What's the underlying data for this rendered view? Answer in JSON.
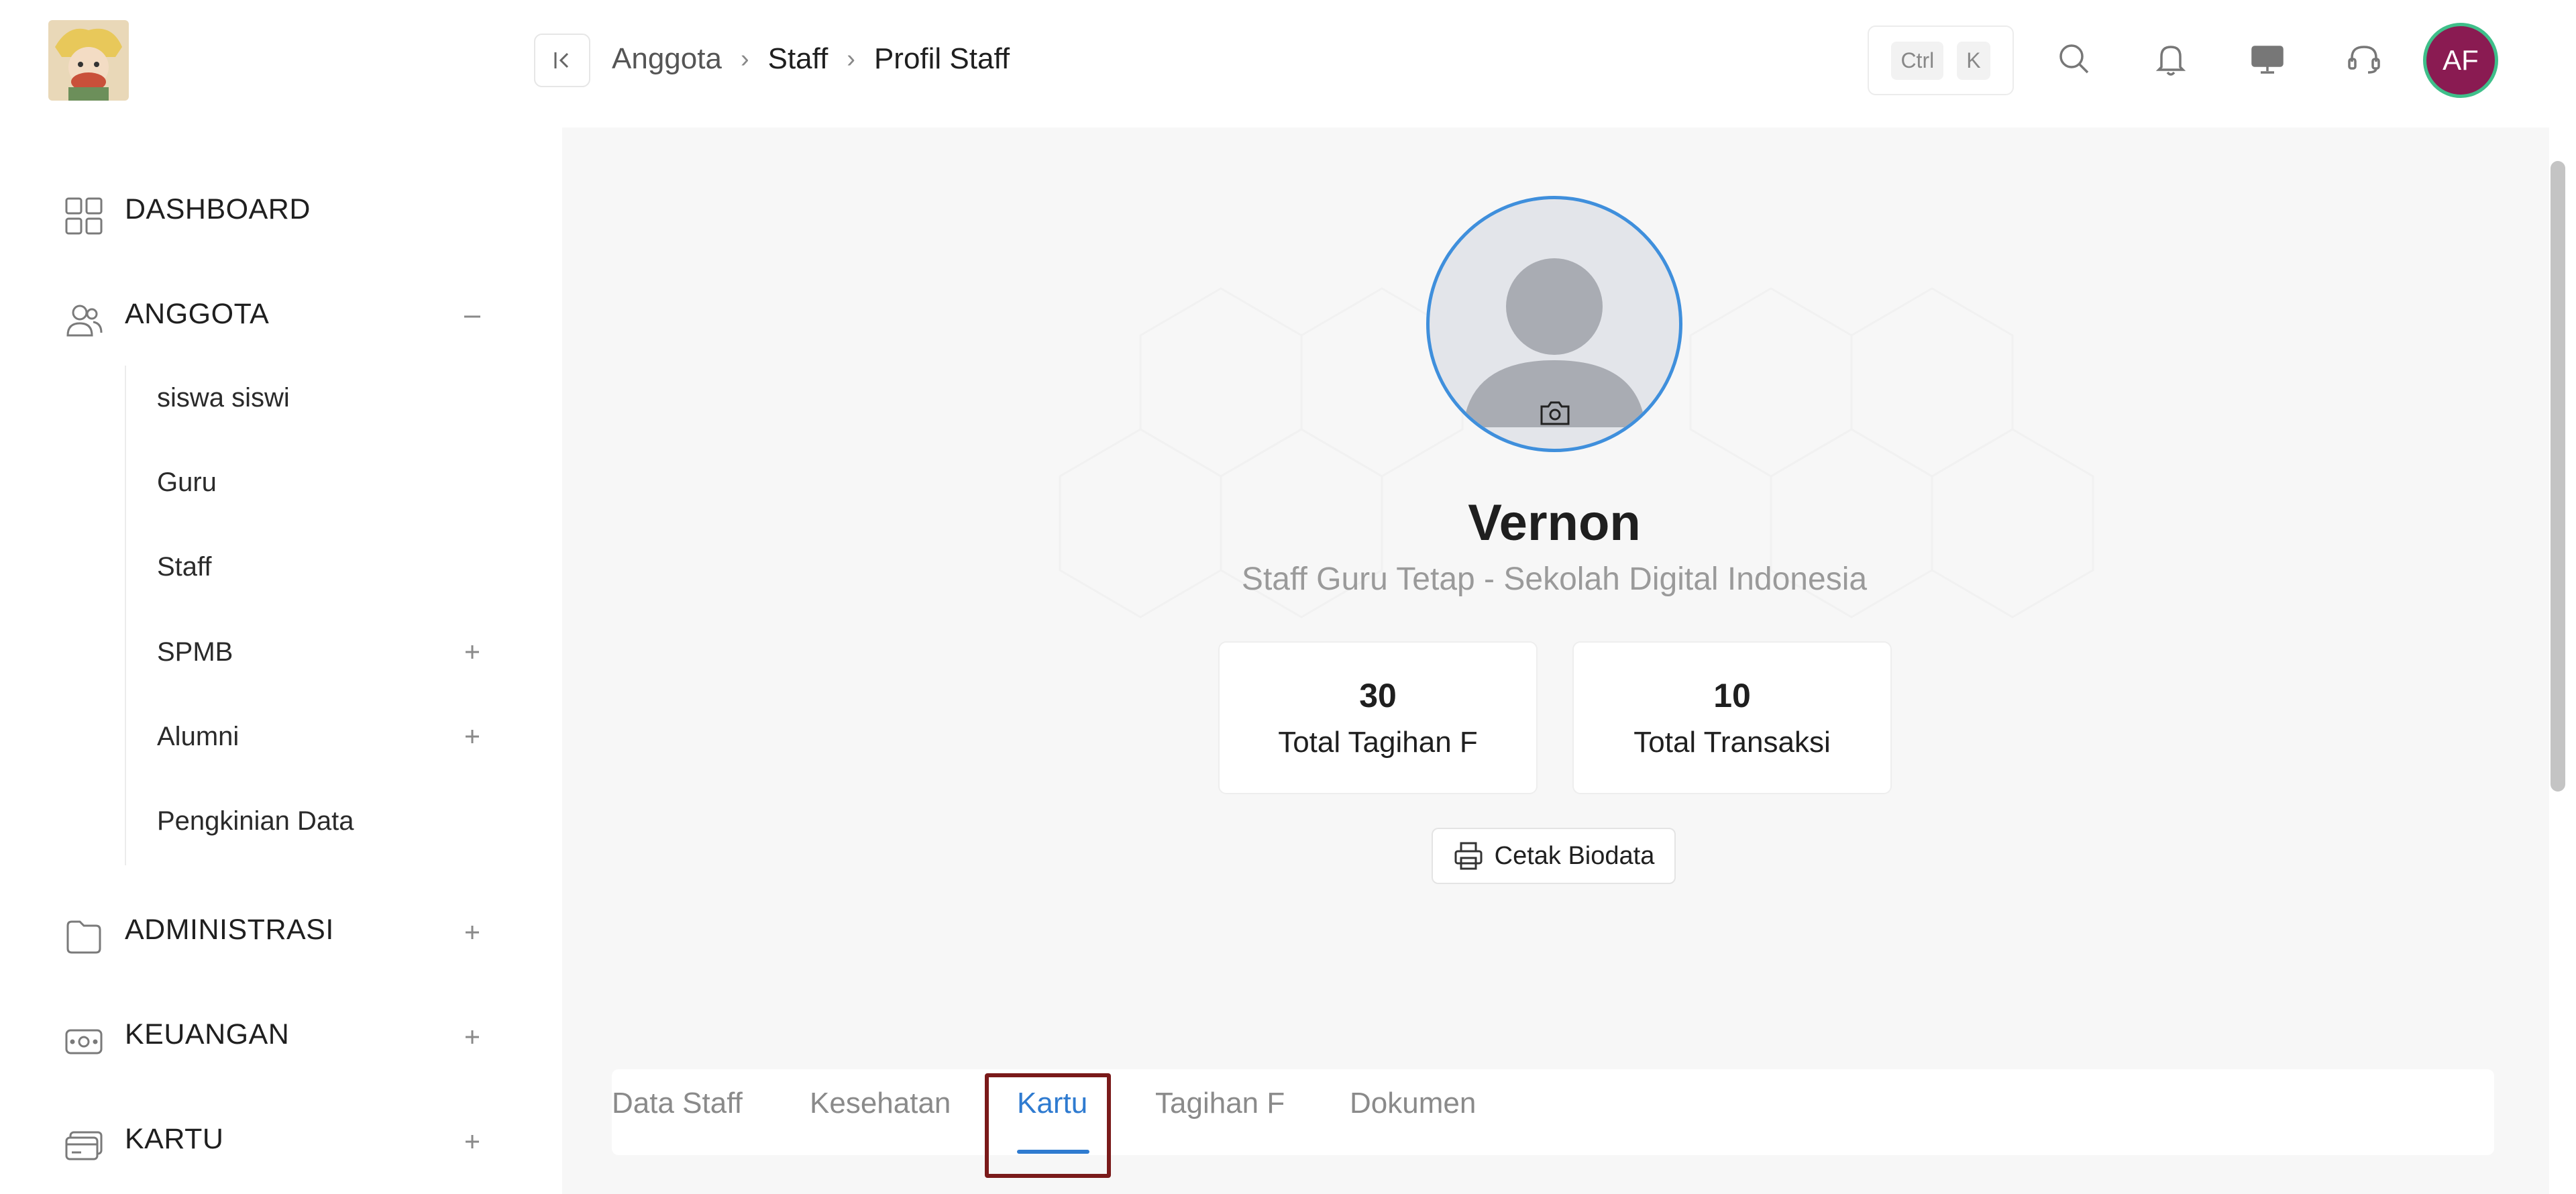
{
  "breadcrumb": {
    "items": [
      "Anggota",
      "Staff",
      "Profil Staff"
    ]
  },
  "shortcut": {
    "ctrl": "Ctrl",
    "key": "K"
  },
  "user": {
    "initials": "AF"
  },
  "sidebar": {
    "items": [
      {
        "label": "DASHBOARD",
        "icon": "dashboard-grid-icon"
      },
      {
        "label": "ANGGOTA",
        "icon": "users-icon",
        "toggle": "collapse"
      },
      {
        "label": "ADMINISTRASI",
        "icon": "folder-icon",
        "toggle": "expand"
      },
      {
        "label": "KEUANGAN",
        "icon": "money-icon",
        "toggle": "expand"
      },
      {
        "label": "KARTU",
        "icon": "card-icon",
        "toggle": "expand"
      }
    ],
    "anggota_sub": [
      {
        "label": "siswa siswi"
      },
      {
        "label": "Guru"
      },
      {
        "label": "Staff"
      },
      {
        "label": "SPMB",
        "toggle": "expand"
      },
      {
        "label": "Alumni",
        "toggle": "expand"
      },
      {
        "label": "Pengkinian Data"
      }
    ]
  },
  "profile": {
    "name": "Vernon",
    "subtitle": "Staff Guru Tetap - Sekolah Digital Indonesia",
    "stats": [
      {
        "value": "30",
        "label": "Total Tagihan F"
      },
      {
        "value": "10",
        "label": "Total Transaksi"
      }
    ],
    "print_label": "Cetak Biodata"
  },
  "tabs": {
    "items": [
      "Data Staff",
      "Kesehatan",
      "Kartu",
      "Tagihan F",
      "Dokumen"
    ],
    "active": "Kartu"
  },
  "colors": {
    "accent": "#2f7bd0",
    "avatar_bg": "#8a1b52",
    "avatar_ring": "#3fbf8a",
    "highlight_box": "#7a1a1a"
  }
}
